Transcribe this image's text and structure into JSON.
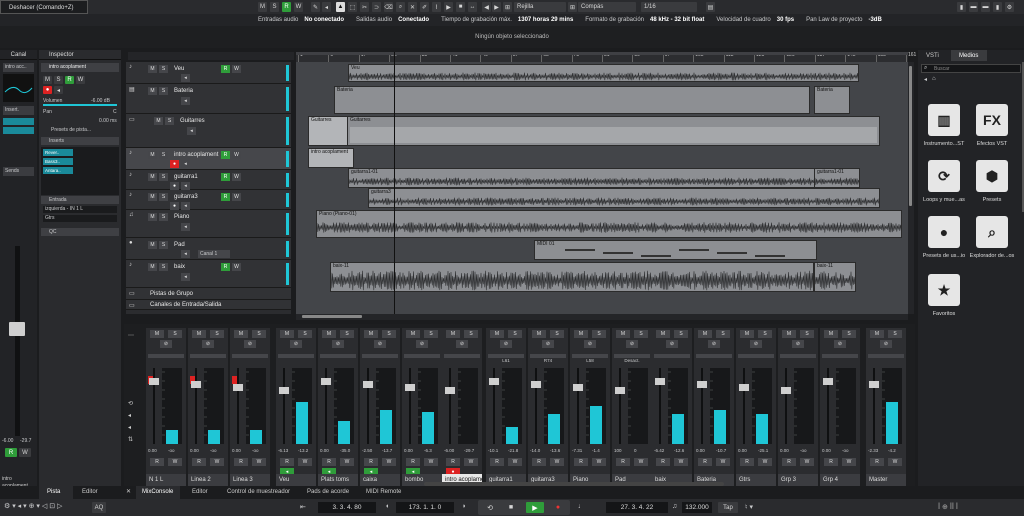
{
  "tooltip": "Deshacer (Comando+Z)",
  "topbar": {
    "ms_r_w": [
      "M",
      "S",
      "R",
      "W"
    ],
    "grid_label": "Rejilla",
    "quantize_label": "Compás",
    "quantize_value": "1/16"
  },
  "infobar": [
    {
      "label": "Entradas audio",
      "value": "No conectado"
    },
    {
      "label": "Salidas audio",
      "value": "Conectado"
    },
    {
      "label": "Tiempo de grabación máx.",
      "value": "1307 horas 29 mins"
    },
    {
      "label": "Formato de grabación",
      "value": "48 kHz - 32 bit float"
    },
    {
      "label": "Velocidad de cuadro",
      "value": "30 fps"
    },
    {
      "label": "Pan Law de proyecto",
      "value": "-3dB"
    }
  ],
  "status": "Ningún objeto seleccionado",
  "channel": {
    "tab": "Canal",
    "track_name": "intro acc..",
    "inserts": "Insert.",
    "sends": "Sends",
    "fader_values": [
      "-6.00",
      "-29.7"
    ],
    "bottom_label": "intro acoplament"
  },
  "inspector": {
    "tab": "Inspector",
    "track": "intro acoplament",
    "volume_label": "Volumen",
    "volume_value": "-6.00 dB",
    "pan_label": "Pan",
    "pan_value": "C",
    "delay_value": "0.00 ms",
    "preset": "Presets de pista...",
    "inserts_label": "Inserts",
    "inserts": [
      "Rever..",
      "Bass3..",
      "Antara.."
    ],
    "routing_label": "Entrada",
    "input": "izquierda - IN 1 L",
    "output": "Gtrs",
    "qc_label": "QC",
    "bottom_tabs": [
      "Pista",
      "Editor"
    ]
  },
  "tracks": [
    {
      "name": "Veu"
    },
    {
      "name": "Bateria"
    },
    {
      "name": "Guitarres"
    },
    {
      "name": "intro acoplament"
    },
    {
      "name": "guitarra1"
    },
    {
      "name": "guitarra3"
    },
    {
      "name": "Piano"
    },
    {
      "name": "Pad",
      "extra": "Canal 1"
    },
    {
      "name": "baix"
    },
    {
      "name": "Pistas de Grupo"
    },
    {
      "name": "Canales de Entrada/Salida"
    }
  ],
  "timeline_ticks": [
    "1",
    "9",
    "17",
    "25",
    "33",
    "41",
    "49",
    "57",
    "65",
    "73",
    "81",
    "89",
    "97",
    "105",
    "113",
    "121",
    "129",
    "137",
    "145",
    "153",
    "161"
  ],
  "clips": [
    {
      "name": "Veu"
    },
    {
      "name": "Bateria"
    },
    {
      "name": "Bateria"
    },
    {
      "name": "Guitarres"
    },
    {
      "name": "Guitarres"
    },
    {
      "name": "intro acoplament"
    },
    {
      "name": "guitarra1-01"
    },
    {
      "name": "guitarra1-01"
    },
    {
      "name": "guitarra3"
    },
    {
      "name": "Piano (Piano-01)"
    },
    {
      "name": "MIDI 01"
    },
    {
      "name": "baix-11"
    },
    {
      "name": "baix-11"
    }
  ],
  "mixer": {
    "strips": [
      {
        "name": "N 1 L",
        "vol": "0.00",
        "pk": "-oo"
      },
      {
        "name": "Linea 2",
        "vol": "0.00",
        "pk": "-oo"
      },
      {
        "name": "Linea 3",
        "vol": "0.00",
        "pk": "-oo"
      },
      {
        "name": "Veu",
        "vol": "-6.13",
        "pk": "-13.2"
      },
      {
        "name": "Plats toms",
        "vol": "0.00",
        "pk": "-35.0"
      },
      {
        "name": "caixa",
        "vol": "-2.50",
        "pk": "-13.7"
      },
      {
        "name": "bombo",
        "vol": "0.00",
        "pk": "-6.3"
      },
      {
        "name": "intro acoplament",
        "vol": "-6.00",
        "pk": "-29.7"
      },
      {
        "name": "guitarra1",
        "vol": "-10.1",
        "pk": "-21.8"
      },
      {
        "name": "guitarra3",
        "vol": "-14.0",
        "pk": "-13.6"
      },
      {
        "name": "Piano",
        "vol": "-7.31",
        "pk": "-1.4"
      },
      {
        "name": "Pad",
        "vol": "100",
        "pk": "0"
      },
      {
        "name": "baix",
        "vol": "-6.42",
        "pk": "-12.6"
      },
      {
        "name": "Bateria",
        "vol": "0.00",
        "pk": "-10.7"
      },
      {
        "name": "Gtrs",
        "vol": "0.00",
        "pk": "-25.1"
      },
      {
        "name": "Grp 3",
        "vol": "0.00",
        "pk": "-oo"
      },
      {
        "name": "Grp 4",
        "vol": "0.00",
        "pk": "-oo"
      },
      {
        "name": "Master",
        "vol": "-2.33",
        "pk": "-4.2"
      }
    ],
    "pan_labels": [
      "L61",
      "R74",
      "L58",
      "Desact."
    ],
    "levels": [
      0.18,
      0.18,
      0.18,
      0.55,
      0.3,
      0.45,
      0.42,
      0.0,
      0.22,
      0.4,
      0.5,
      0.0,
      0.4,
      0.45,
      0.4,
      0.0,
      0.0,
      0.55
    ]
  },
  "bottom_tabs": {
    "left": [
      "Pista",
      "Editor"
    ],
    "center": [
      "MixConsole",
      "Editor",
      "Control de muestreador",
      "Pads de acorde",
      "MIDI Remote"
    ]
  },
  "right": {
    "tabs": [
      "VSTi",
      "Medios"
    ],
    "search_placeholder": "Buscar",
    "tiles": [
      {
        "label": "Instrumento...ST",
        "icon": "piano"
      },
      {
        "label": "Efectos VST",
        "icon": "FX"
      },
      {
        "label": "Loops y mue...as",
        "icon": "loop"
      },
      {
        "label": "Presets",
        "icon": "hex"
      },
      {
        "label": "Presets de us...io",
        "icon": "user"
      },
      {
        "label": "Explorador de...os",
        "icon": "explorer"
      },
      {
        "label": "Favoritos",
        "icon": "star"
      }
    ]
  },
  "transport": {
    "left_pos": "3. 3. 4. 80",
    "punch_pos": "173. 1. 1. 0",
    "main_pos": "27. 3. 4. 22",
    "tempo": "132.000",
    "tap": "Tap",
    "aq": "AQ"
  },
  "colors": {
    "accent_green": "#2f9d3a",
    "record_red": "#d22222",
    "meter_cyan": "#1fc6d6",
    "clip_grey": "#8d8f93"
  }
}
